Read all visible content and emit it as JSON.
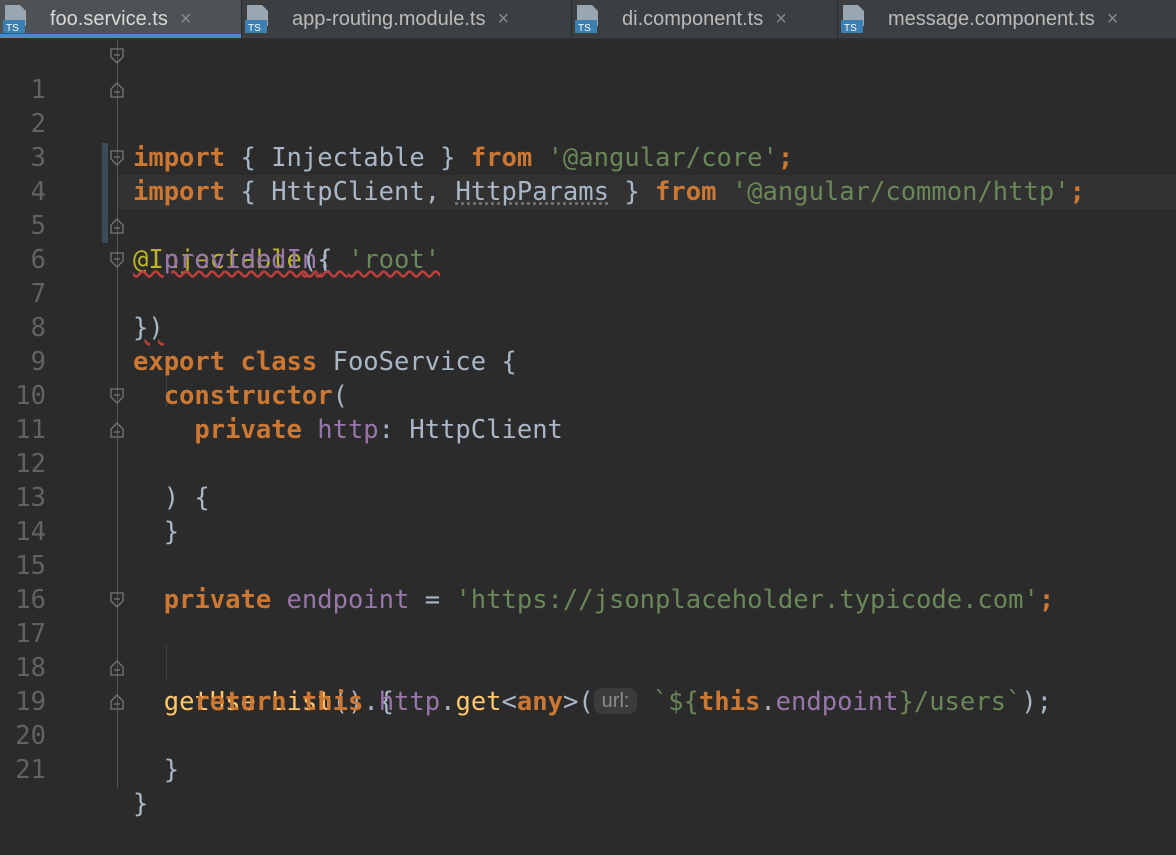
{
  "tabs": [
    {
      "label": "foo.service.ts",
      "active": true,
      "icon": "typescript-file-icon"
    },
    {
      "label": "app-routing.module.ts",
      "active": false,
      "icon": "typescript-file-icon"
    },
    {
      "label": "di.component.ts",
      "active": false,
      "icon": "typescript-file-icon"
    },
    {
      "label": "message.component.ts",
      "active": false,
      "icon": "typescript-file-icon"
    }
  ],
  "tab_close_glyph": "×",
  "ts_icon_text": "TS",
  "line_numbers": [
    "1",
    "2",
    "3",
    "4",
    "5",
    "6",
    "7",
    "8",
    "9",
    "10",
    "11",
    "12",
    "13",
    "14",
    "15",
    "16",
    "17",
    "18",
    "19",
    "20",
    "21"
  ],
  "code": {
    "l1": {
      "import": "import",
      "b1": " { ",
      "name": "Injectable",
      "b2": " } ",
      "from": "from",
      "sp": " ",
      "mod": "'@angular/core'",
      "semi": ";"
    },
    "l2": {
      "import": "import",
      "b1": " { ",
      "name1": "HttpClient",
      "comma": ", ",
      "name2": "HttpParams",
      "b2": " } ",
      "from": "from",
      "sp": " ",
      "mod": "'@angular/common/http'",
      "semi": ";"
    },
    "l4": {
      "dec": "@Injectable",
      "open": "({"
    },
    "l5": {
      "indent": "  ",
      "key": "providedIn",
      "colon": ": ",
      "val": "'root'"
    },
    "l6": {
      "close": "})"
    },
    "l7": {
      "export": "export",
      "sp1": " ",
      "class": "class",
      "name": " FooService {"
    },
    "l9": {
      "indent": "  ",
      "ctor": "constructor",
      "open": "("
    },
    "l10": {
      "indent": "    ",
      "private": "private",
      "sp": " ",
      "param": "http",
      "type": ": HttpClient"
    },
    "l11": {
      "text": "  ) {"
    },
    "l12": {
      "text": "  }"
    },
    "l15": {
      "indent": "  ",
      "private": "private",
      "sp": " ",
      "field": "endpoint",
      "eq": " = ",
      "val": "'https://jsonplaceholder.typicode.com'",
      "semi": ";"
    },
    "l17": {
      "indent": "  ",
      "fn": "getUserList",
      "rest": "() {"
    },
    "l18": {
      "indent": "    ",
      "return": "return",
      "sp": " ",
      "this1": "this",
      "dot1": ".",
      "http": "http",
      "dot2": ".",
      "get": "get",
      "lt": "<",
      "any": "any",
      "gt": ">(",
      "hint": "url:",
      "tpl1": " `${",
      "this2": "this",
      "dot3": ".",
      "endpoint": "endpoint",
      "tpl2": "}/users`",
      "end": ");"
    },
    "l19": {
      "text": "  }"
    },
    "l20": {
      "text": "}"
    }
  },
  "colors": {
    "background": "#2b2b2b",
    "keyword": "#cc7832",
    "string": "#6a8759",
    "function": "#ffc66d",
    "property": "#9876aa",
    "decorator": "#bbb529",
    "active_tab_underline": "#4a88c7"
  }
}
